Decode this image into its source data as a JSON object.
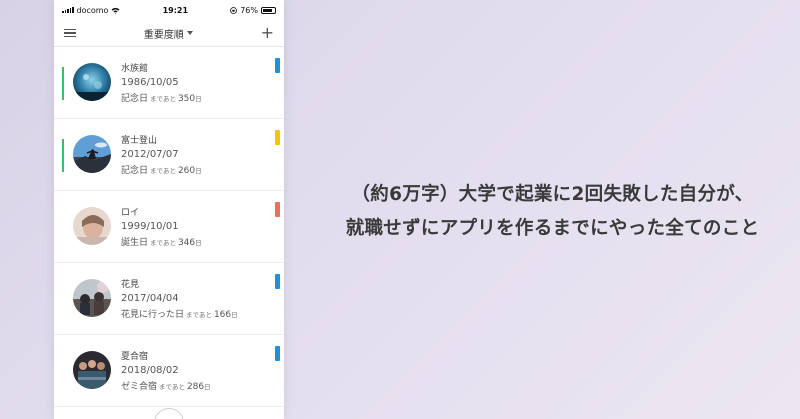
{
  "status_bar": {
    "carrier": "docomo",
    "time": "19:21",
    "battery_percent": "76%"
  },
  "nav": {
    "sort_label": "重要度順"
  },
  "events": [
    {
      "title": "水族館",
      "date": "1986/10/05",
      "type": "記念日",
      "suffix": "まであと",
      "days": "350",
      "unit": "日",
      "tag_color": "#1f8fd6",
      "highlight": true,
      "photo": "aquarium"
    },
    {
      "title": "富士登山",
      "date": "2012/07/07",
      "type": "記念日",
      "suffix": "まであと",
      "days": "260",
      "unit": "日",
      "tag_color": "#f1c40f",
      "highlight": true,
      "photo": "mountain"
    },
    {
      "title": "ロイ",
      "date": "1999/10/01",
      "type": "誕生日",
      "suffix": "まであと",
      "days": "346",
      "unit": "日",
      "tag_color": "#e8705f",
      "highlight": false,
      "photo": "portrait"
    },
    {
      "title": "花見",
      "date": "2017/04/04",
      "type": "花見に行った日",
      "suffix": "まであと",
      "days": "166",
      "unit": "日",
      "tag_color": "#1f8fd6",
      "highlight": false,
      "photo": "flowers"
    },
    {
      "title": "夏合宿",
      "date": "2018/08/02",
      "type": "ゼミ合宿",
      "suffix": "まであと",
      "days": "286",
      "unit": "日",
      "tag_color": "#1f8fd6",
      "highlight": false,
      "photo": "group"
    }
  ],
  "headline": {
    "line1": "（約6万字）大学で起業に2回失敗した自分が、",
    "line2": "就職せずにアプリを作るまでにやった全てのこと"
  }
}
